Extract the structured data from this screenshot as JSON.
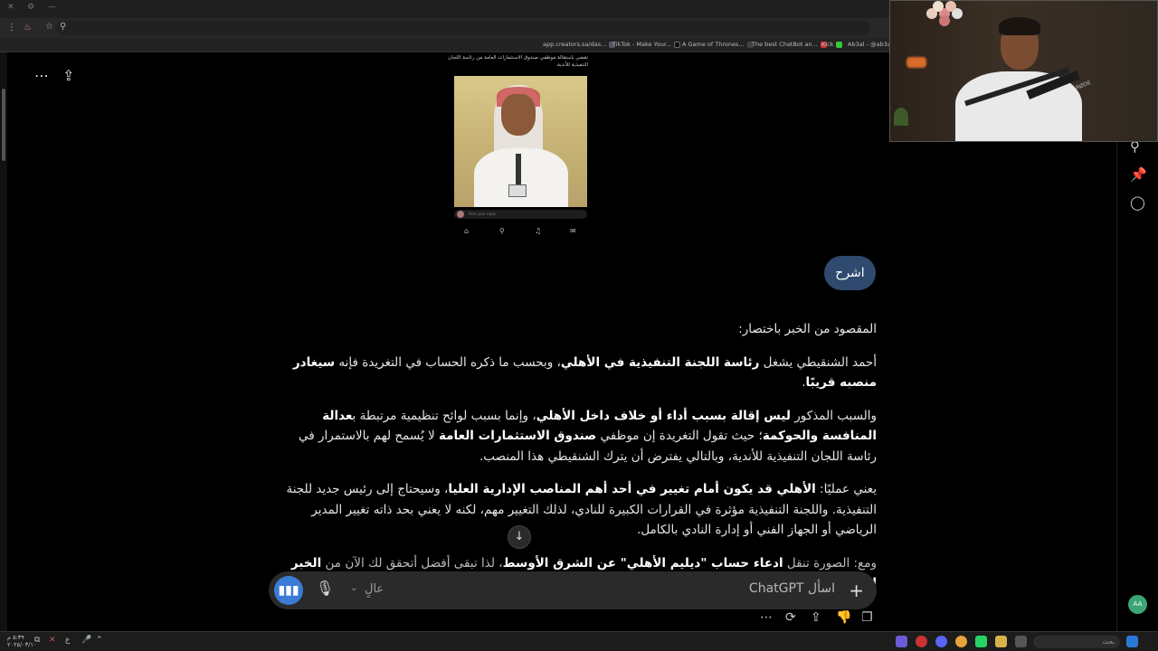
{
  "browser": {
    "window_controls": [
      "✕",
      "⚙",
      "—"
    ],
    "bookmarks": [
      {
        "label": "app.creators.sa/das...",
        "color": "#555"
      },
      {
        "label": "TikTok - Make Your...",
        "color": "#111"
      },
      {
        "label": "A Game of Thrones...",
        "color": "#444"
      },
      {
        "label": "The best ChatBot an...",
        "color": "#c33"
      },
      {
        "label": "Kick",
        "color": "#222"
      },
      {
        "label": "Ab3al - @ab3al",
        "color": "#3c3"
      }
    ]
  },
  "embedded_image": {
    "caption": "تقضي باستقالة موظفي صندوق الاستثمارات العامة من رئاسة اللجان التنفيذية للأندية.",
    "reply_placeholder": "Post your reply"
  },
  "chat": {
    "user_message": "اشرح",
    "answer": {
      "intro": "المقصود من الخبر باختصار:",
      "p1_a": "أحمد الشنقيطي يشغل ",
      "p1_b": "رئاسة اللجنة التنفيذية في الأهلي",
      "p1_c": "، وبحسب ما ذكره الحساب في التغريدة فإنه ",
      "p1_d": "سيغادر منصبه قريبًا",
      "p1_e": ".",
      "p2_a": "والسبب المذكور ",
      "p2_b": "ليس إقالة بسبب أداء أو خلاف داخل الأهلي",
      "p2_c": "، وإنما بسبب لوائح تنظيمية مرتبطة ب",
      "p2_d": "عدالة المنافسة والحوكمة",
      "p2_e": "؛ حيث تقول التغريدة إن موظفي ",
      "p2_f": "صندوق الاستثمارات العامة",
      "p2_g": " لا يُسمح لهم بالاستمرار في رئاسة اللجان التنفيذية للأندية، وبالتالي يفترض أن يترك الشنقيطي هذا المنصب.",
      "p3_a": "يعني عمليًا: ",
      "p3_b": "الأهلي قد يكون أمام تغيير في أحد أهم المناصب الإدارية العليا",
      "p3_c": "، وسيحتاج إلى رئيس جديد للجنة التنفيذية. واللجنة التنفيذية مؤثرة في القرارات الكبيرة للنادي، لذلك التغيير مهم، لكنه لا يعني بحد ذاته تغيير المدير الرياضي أو الجهاز الفني أو إدارة النادي بالكامل.",
      "p4_a": "ومع: الصورة تنقل ",
      "p4_b": "ادعاء حساب \"ديليم الأهلي\" عن الشرق الأوسط",
      "p4_c": "، لذا تبقى أفضل أتحقق لك الآن من ",
      "p4_d": "الخبر الأصلي في"
    }
  },
  "composer": {
    "placeholder": "اسأل ChatGPT",
    "mode_label": "عالٍ"
  },
  "sidebar": {
    "avatar_initials": "AA"
  },
  "taskbar": {
    "time": "٥:٣٩ م",
    "date": "٢٠٢٥/٠٣/١٠",
    "search_placeholder": "بحث",
    "lang": "ع"
  },
  "webcam": {
    "mic_label": "RØDE"
  }
}
